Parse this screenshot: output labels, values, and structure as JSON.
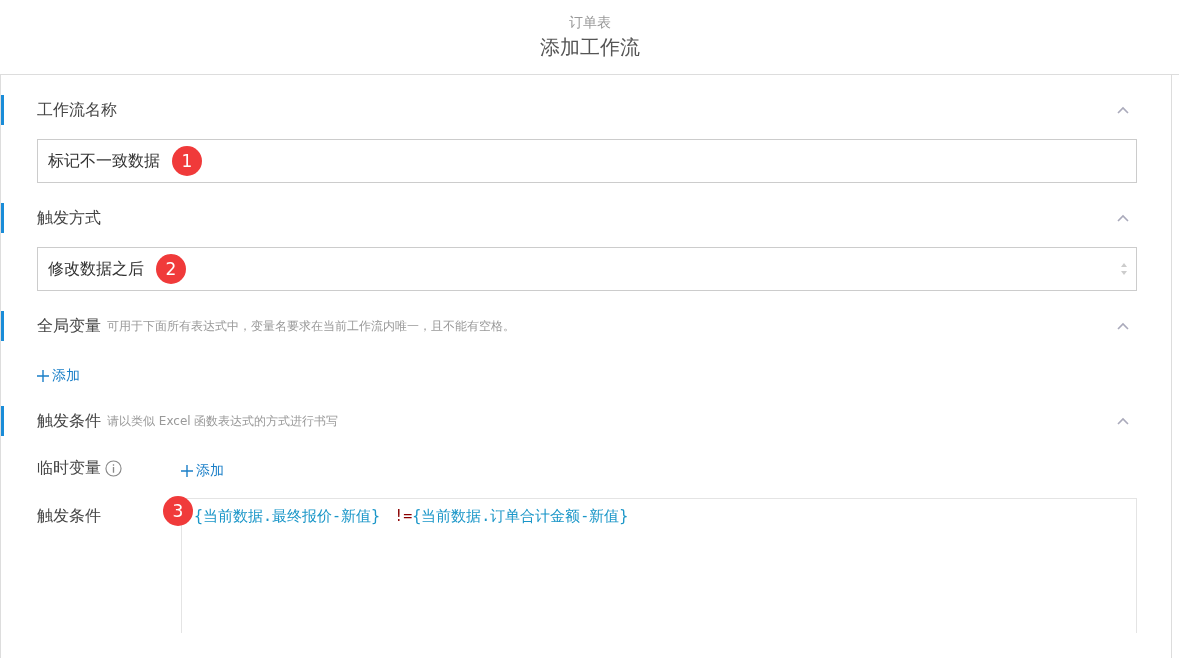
{
  "header": {
    "subtitle": "订单表",
    "title": "添加工作流"
  },
  "sections": [
    {
      "kind": "text",
      "title": "工作流名称",
      "expanded": true,
      "value": "标记不一致数据",
      "badge": "1"
    },
    {
      "kind": "select",
      "title": "触发方式",
      "expanded": true,
      "value": "修改数据之后",
      "badge": "2"
    },
    {
      "kind": "add",
      "title": "全局变量",
      "hint": "可用于下面所有表达式中，变量名要求在当前工作流内唯一，且不能有空格。",
      "expanded": true,
      "add_label": "添加"
    },
    {
      "kind": "condition",
      "title": "触发条件",
      "hint": "请以类似 Excel 函数表达式的方式进行书写",
      "expanded": true,
      "temp_label": "临时变量",
      "add_label": "添加",
      "condition_label": "触发条件",
      "badge": "3",
      "tokens": [
        {
          "kind": "field",
          "text": "{当前数据.最终报价-新值}"
        },
        {
          "kind": "operator",
          "text": "!="
        },
        {
          "kind": "field",
          "text": "{当前数据.订单合计金额-新值}"
        }
      ]
    }
  ]
}
